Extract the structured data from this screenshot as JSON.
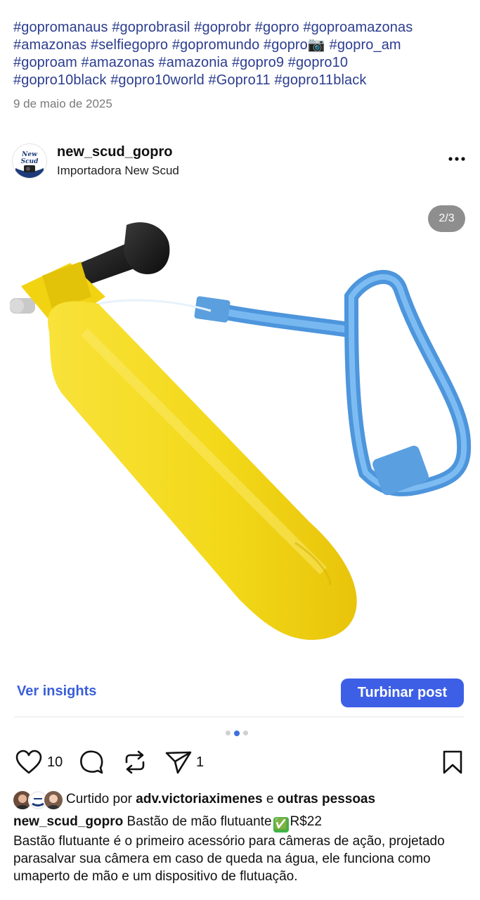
{
  "hashtags": {
    "lines": [
      [
        "#gopromanaus",
        "#goprobrasil",
        "#goprobr",
        "#gopro",
        "#goproamazonas"
      ],
      [
        "#amazonas",
        "#selfiegopro",
        "#gopromundo",
        "#gopro📷",
        "#gopro_am"
      ],
      [
        "#goproam",
        "#amazonas",
        "#amazonia",
        "#gopro9",
        "#gopro10"
      ],
      [
        "#gopro10black",
        "#gopro10world",
        "#Gopro11",
        "#gopro11black"
      ]
    ]
  },
  "date": "9 de maio de 2025",
  "post": {
    "username": "new_scud_gopro",
    "location": "Importadora New Scud",
    "avatar_text": "New Scud",
    "more_icon": "ellipsis-icon"
  },
  "media": {
    "counter": "2/3",
    "carousel": {
      "total": 3,
      "active": 2
    }
  },
  "buttons": {
    "insights": "Ver insights",
    "boost": "Turbinar post"
  },
  "actions": {
    "likes": "10",
    "shares": "1"
  },
  "liked_by": {
    "prefix": "Curtido por",
    "user": "adv.victoriaximenes",
    "connector": "e",
    "others": "outras pessoas"
  },
  "caption": {
    "username": "new_scud_gopro",
    "title": "Bastão de mão flutuante",
    "check_emoji": "✅",
    "price": "R$22",
    "body": "Bastão flutuante é o primeiro acessório para câmeras de ação, projetado parasalvar sua câmera em caso de queda na água, ele funciona como umaperto de mão e um dispositivo de flutuação."
  },
  "colors": {
    "link": "#2c3d8f",
    "accent": "#3d5fe6",
    "float_yellow": "#f6dc1f",
    "strap_blue": "#5aa9ec"
  }
}
